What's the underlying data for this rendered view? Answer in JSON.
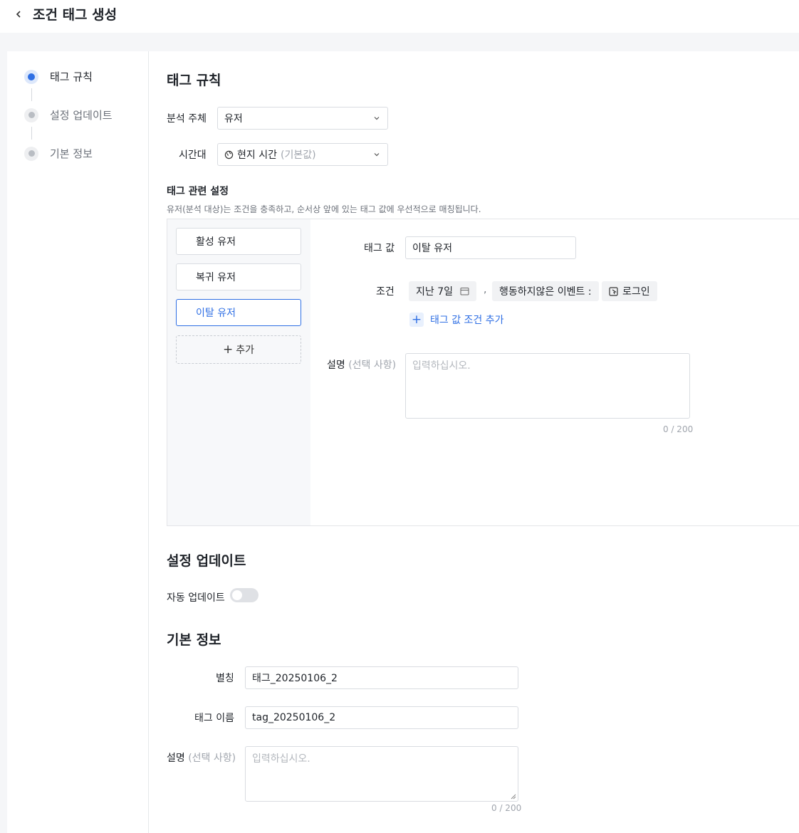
{
  "header": {
    "title": "조건 태그 생성"
  },
  "steps": [
    {
      "label": "태그 규칙",
      "state": "active"
    },
    {
      "label": "설정 업데이트",
      "state": "idle"
    },
    {
      "label": "기본 정보",
      "state": "idle"
    }
  ],
  "tag_rule": {
    "title": "태그 규칙",
    "subject_label": "분석 주체",
    "subject_value": "유저",
    "timezone_label": "시간대",
    "timezone_value": "현지 시간",
    "timezone_hint": "(기본값)",
    "settings_title": "태그 관련 설정",
    "settings_desc": "유저(분석 대상)는 조건을 충족하고, 순서상 앞에 있는 태그 값에 우선적으로 매칭됩니다.",
    "tag_items": [
      "활성 유저",
      "복귀 유저",
      "이탈 유저"
    ],
    "selected_index": 2,
    "add_label": "추가",
    "tag_value_label": "태그 값",
    "tag_value": "이탈 유저",
    "condition_label": "조건",
    "condition_period": "지난 7일",
    "condition_type": "행동하지않은 이벤트 :",
    "condition_event": "로그인",
    "add_condition_label": "태그 값 조건 추가",
    "desc_label": "설명",
    "desc_optional": "(선택 사항)",
    "desc_placeholder": "입력하십시오.",
    "desc_counter": "0 / 200"
  },
  "update": {
    "title": "설정 업데이트",
    "auto_label": "자동 업데이트",
    "auto_enabled": false
  },
  "basic": {
    "title": "기본 정보",
    "alias_label": "별칭",
    "alias_value": "태그_20250106_2",
    "name_label": "태그 이름",
    "name_value": "tag_20250106_2",
    "desc_label": "설명",
    "desc_optional": "(선택 사항)",
    "desc_placeholder": "입력하십시오.",
    "desc_counter": "0 / 200"
  },
  "colors": {
    "accent": "#2f6fe4",
    "border": "#d9dce1",
    "muted": "#a0a5ad"
  },
  "icons": [
    "back-arrow-icon",
    "chevron-down-icon",
    "globe-icon",
    "calendar-icon",
    "event-icon",
    "plus-icon"
  ]
}
